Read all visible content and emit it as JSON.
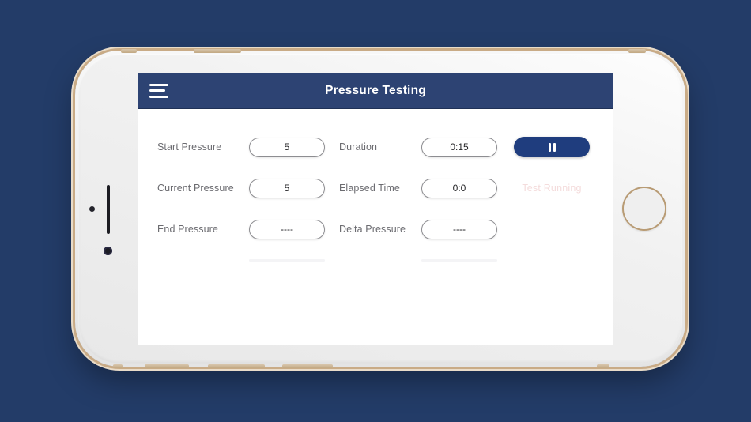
{
  "device": {
    "type": "smartphone-mockup",
    "orientation": "landscape",
    "frame_color": "#e9dcc9",
    "body_color": "#f2f2f2"
  },
  "background": {
    "color": "#233c68"
  },
  "app": {
    "header": {
      "title": "Pressure Testing",
      "background_color": "#2d4373",
      "title_color": "#ffffff",
      "menu_icon": "hamburger-menu-icon"
    },
    "rows": [
      {
        "label_left": "Start Pressure",
        "value_left": "5",
        "label_right": "Duration",
        "value_right": "0:15"
      },
      {
        "label_left": "Current Pressure",
        "value_left": "5",
        "label_right": "Elapsed Time",
        "value_right": "0:0"
      },
      {
        "label_left": "End Pressure",
        "value_left": "----",
        "label_right": "Delta Pressure",
        "value_right": "----"
      }
    ],
    "controls": {
      "pause_button": {
        "icon": "pause-icon",
        "label": "",
        "color": "#1f3d7e"
      },
      "status": {
        "text": "Test Running",
        "color": "#f4dcdc"
      }
    }
  }
}
